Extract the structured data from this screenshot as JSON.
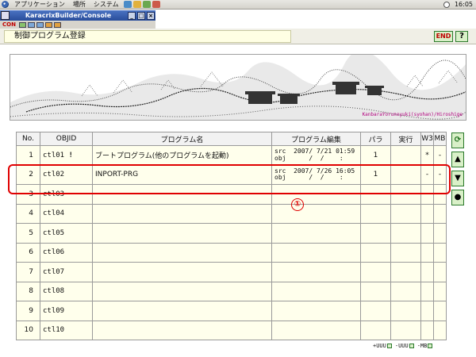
{
  "topbar": {
    "menus": [
      "アプリケーション",
      "場所",
      "システム"
    ],
    "clock": "16:05"
  },
  "console_window": {
    "title": "KaracrixBuilder/Console",
    "min_label": "_",
    "max_label": "□",
    "close_label": "×",
    "tab_label": "CON"
  },
  "header": {
    "title": "制御プログラム登録",
    "end_label": "END",
    "help_label": "?"
  },
  "banner": {
    "caption": "KanbaraYorunoyuki(syohan)/Hiroshige"
  },
  "table": {
    "columns": [
      "No.",
      "OBJID",
      "プログラム名",
      "プログラム編集",
      "パラ",
      "実行",
      "W3",
      "MB"
    ],
    "rows": [
      {
        "no": "1",
        "objid": "ctl01",
        "mark": "!",
        "name": "ブートプログラム(他のプログラムを起動)",
        "edit_src": "src  2007/ 7/21 01:59",
        "edit_obj": "obj      /  /    :",
        "para": "1",
        "exec": "",
        "w3": "*",
        "mb": "-"
      },
      {
        "no": "2",
        "objid": "ctl02",
        "mark": "",
        "name": "INPORT-PRG",
        "edit_src": "src  2007/ 7/26 16:05",
        "edit_obj": "obj      /  /    :",
        "para": "1",
        "exec": "",
        "w3": "-",
        "mb": "-"
      },
      {
        "no": "3",
        "objid": "ctl03",
        "mark": "",
        "name": "",
        "edit_src": "",
        "edit_obj": "",
        "para": "",
        "exec": "",
        "w3": "",
        "mb": ""
      },
      {
        "no": "4",
        "objid": "ctl04",
        "mark": "",
        "name": "",
        "edit_src": "",
        "edit_obj": "",
        "para": "",
        "exec": "",
        "w3": "",
        "mb": ""
      },
      {
        "no": "5",
        "objid": "ctl05",
        "mark": "",
        "name": "",
        "edit_src": "",
        "edit_obj": "",
        "para": "",
        "exec": "",
        "w3": "",
        "mb": ""
      },
      {
        "no": "6",
        "objid": "ctl06",
        "mark": "",
        "name": "",
        "edit_src": "",
        "edit_obj": "",
        "para": "",
        "exec": "",
        "w3": "",
        "mb": ""
      },
      {
        "no": "7",
        "objid": "ctl07",
        "mark": "",
        "name": "",
        "edit_src": "",
        "edit_obj": "",
        "para": "",
        "exec": "",
        "w3": "",
        "mb": ""
      },
      {
        "no": "8",
        "objid": "ctl08",
        "mark": "",
        "name": "",
        "edit_src": "",
        "edit_obj": "",
        "para": "",
        "exec": "",
        "w3": "",
        "mb": ""
      },
      {
        "no": "9",
        "objid": "ctl09",
        "mark": "",
        "name": "",
        "edit_src": "",
        "edit_obj": "",
        "para": "",
        "exec": "",
        "w3": "",
        "mb": ""
      },
      {
        "no": "10",
        "objid": "ctl10",
        "mark": "",
        "name": "",
        "edit_src": "",
        "edit_obj": "",
        "para": "",
        "exec": "",
        "w3": "",
        "mb": ""
      }
    ]
  },
  "side_buttons": {
    "refresh": "⟳",
    "up": "▲",
    "down": "▼",
    "dot": "●"
  },
  "annotation": "①",
  "bottom": {
    "uuu": "+UUU",
    "ddd": "-UUU",
    "mb": "-MB"
  },
  "colors": {
    "highlight": "#e00000",
    "row_bg": "#ffffec",
    "button_bg": "#d9f0c8"
  }
}
